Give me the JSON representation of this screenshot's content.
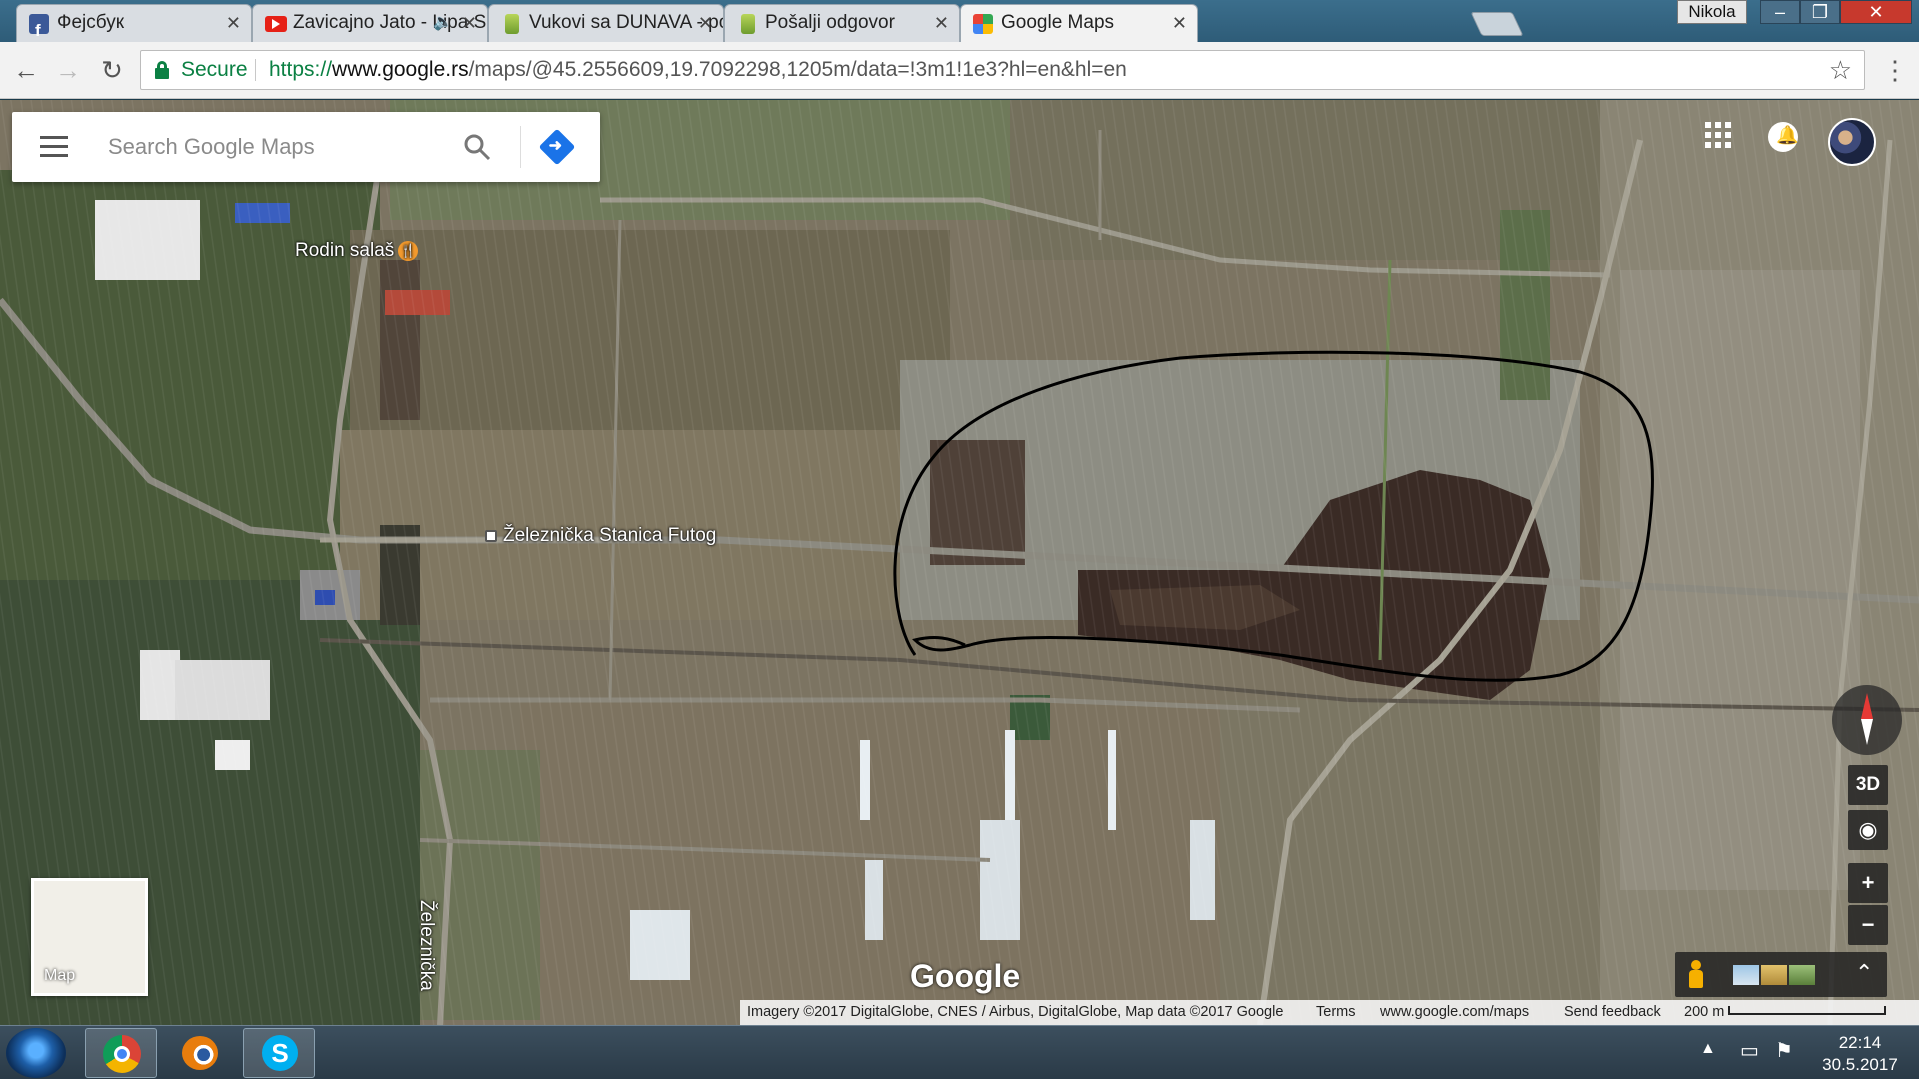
{
  "browser": {
    "tabs": [
      {
        "title": "Фејсбук",
        "icon": "facebook-icon"
      },
      {
        "title": "Zavicajno Jato - Lipa S",
        "icon": "youtube-icon",
        "sound": true
      },
      {
        "title": "Vukovi sa DUNAVA - pod",
        "icon": "forum-icon"
      },
      {
        "title": "Pošalji odgovor",
        "icon": "forum-icon"
      },
      {
        "title": "Google Maps",
        "icon": "google-maps-icon",
        "active": true
      }
    ],
    "profile_name": "Nikola",
    "window_controls": {
      "minimize": "–",
      "maximize": "❐",
      "close": "✕"
    },
    "secure_label": "Secure",
    "url_scheme": "https://",
    "url_host": "www.google.rs",
    "url_path": "/maps/@45.2556609,19.7092298,1205m/data=!3m1!1e3?hl=en&hl=en"
  },
  "maps": {
    "search_placeholder": "Search Google Maps",
    "places": {
      "rodin_salas": "Rodin salaš",
      "station": "Železnička Stanica Futog",
      "street": "Železnička"
    },
    "logo_text": "Google",
    "minimap_label": "Map",
    "button_3d": "3D",
    "zoom_in": "+",
    "zoom_out": "−",
    "footer": {
      "imagery": "Imagery ©2017 DigitalGlobe, CNES / Airbus, DigitalGlobe, Map data ©2017 Google",
      "terms": "Terms",
      "site": "www.google.com/maps",
      "feedback": "Send feedback",
      "scale": "200 m"
    }
  },
  "taskbar": {
    "apps": [
      "chrome-icon",
      "blender-icon",
      "skype-icon"
    ],
    "time": "22:14",
    "date": "30.5.2017"
  },
  "colors": {
    "secure_green": "#0b8043",
    "accent_blue": "#1a73e8",
    "tab_bar": "#3b6e8c"
  }
}
